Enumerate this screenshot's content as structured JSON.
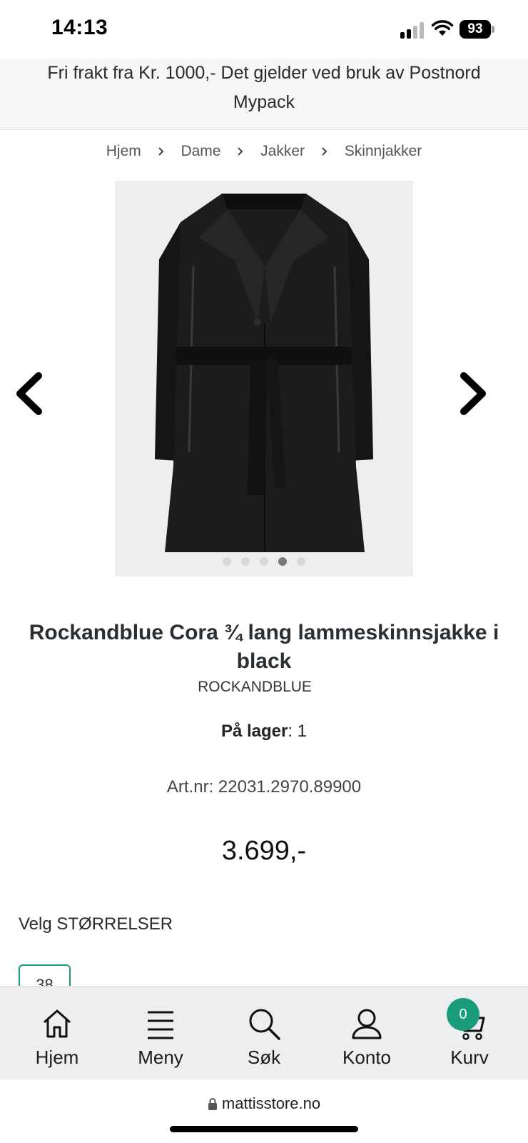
{
  "status_bar": {
    "time": "14:13",
    "battery": "93"
  },
  "banner": {
    "text": "Fri frakt fra Kr. 1000,- Det gjelder ved bruk av Postnord Mypack"
  },
  "breadcrumb": {
    "items": [
      "Hjem",
      "Dame",
      "Jakker",
      "Skinnjakker"
    ]
  },
  "gallery": {
    "image_count": 5,
    "active_index": 3
  },
  "product": {
    "title": "Rockandblue Cora ¾ lang lammeskinnsjakke i black",
    "brand": "ROCKANDBLUE",
    "stock_label": "På lager",
    "stock_value": ": 1",
    "art_nr": "Art.nr: 22031.2970.89900",
    "price": "3.699,-",
    "size_label": "Velg STØRRELSER",
    "sizes": [
      "38"
    ]
  },
  "bottom_nav": {
    "items": [
      {
        "label": "Hjem",
        "icon": "home-icon"
      },
      {
        "label": "Meny",
        "icon": "menu-icon"
      },
      {
        "label": "Søk",
        "icon": "search-icon"
      },
      {
        "label": "Konto",
        "icon": "account-icon"
      },
      {
        "label": "Kurv",
        "icon": "cart-icon"
      }
    ],
    "cart_count": "0"
  },
  "browser": {
    "url": "mattisstore.no"
  },
  "colors": {
    "accent": "#1a9c7a",
    "nav_bg": "#eceef0",
    "banner_bg": "#f6f6f6"
  }
}
